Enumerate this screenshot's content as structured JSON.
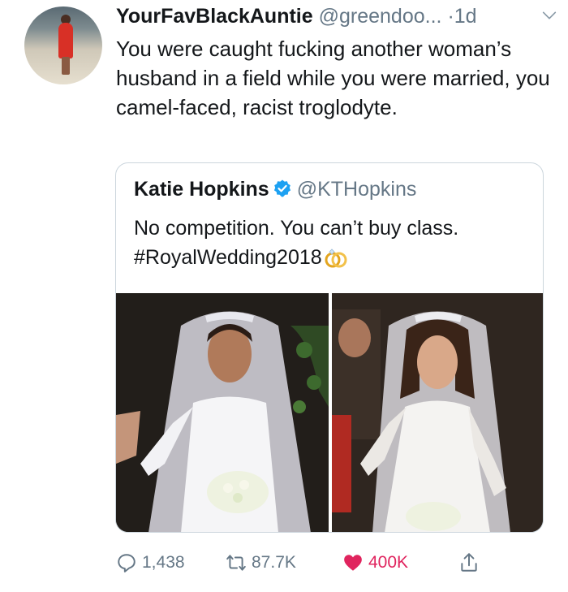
{
  "tweet": {
    "display_name": "YourFavBlackAuntie",
    "handle": "@greendoo...",
    "separator": "·",
    "time": "1d",
    "text": "You were caught fucking another woman’s husband in a field while you were married, you camel-faced, racist troglodyte."
  },
  "quote": {
    "display_name": "Katie Hopkins",
    "handle": "@KTHopkins",
    "text": "No competition. You can’t buy class. #RoyalWedding2018",
    "emoji_icon": "wedding-rings-icon"
  },
  "actions": {
    "reply_count": "1,438",
    "retweet_count": "87.7K",
    "like_count": "400K",
    "like_color": "#e0245e"
  },
  "colors": {
    "text": "#14171a",
    "secondary": "#657786",
    "verified": "#1da1f2",
    "border": "#ccd6dd"
  }
}
